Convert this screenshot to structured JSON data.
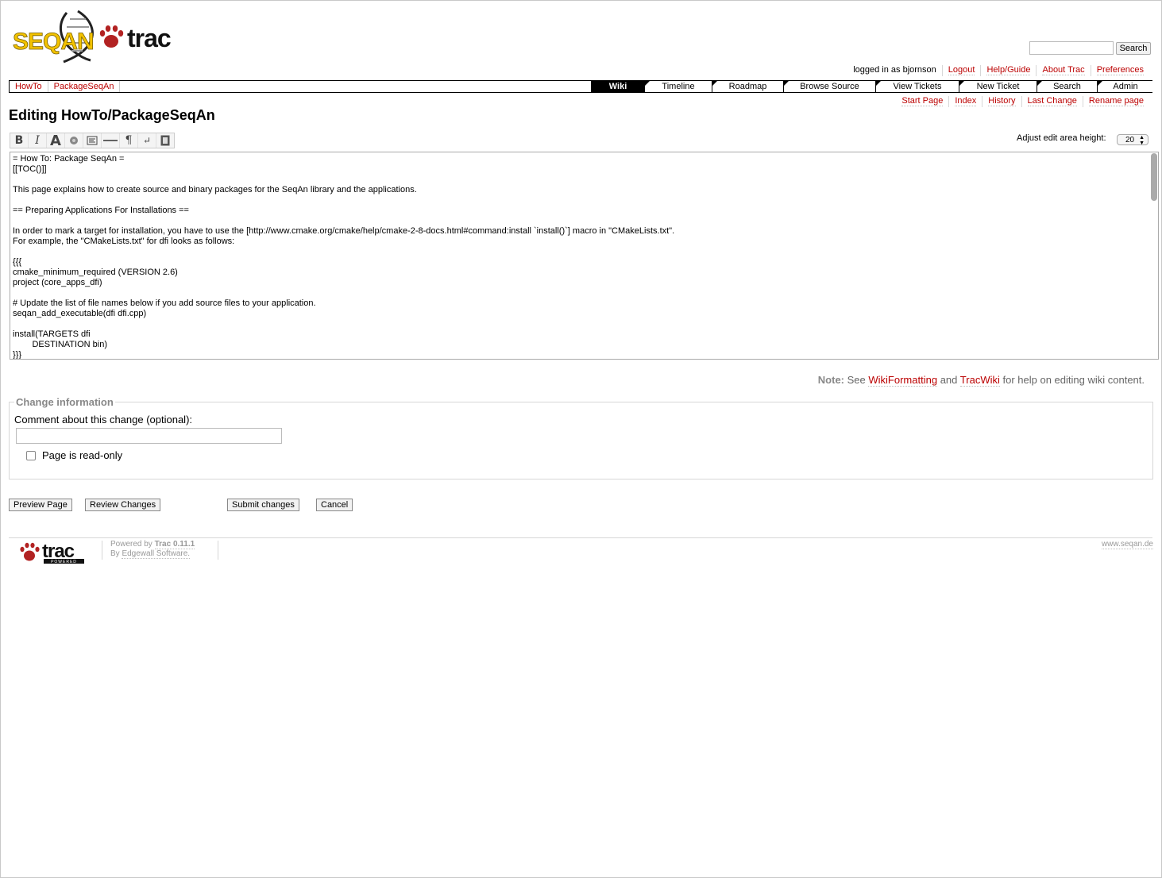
{
  "header": {
    "search_button": "Search",
    "search_value": ""
  },
  "metanav": {
    "logged_in": "logged in as bjornson",
    "logout": "Logout",
    "help": "Help/Guide",
    "about": "About Trac",
    "preferences": "Preferences"
  },
  "context_path": [
    "HowTo",
    "PackageSeqAn"
  ],
  "mainnav": [
    "Wiki",
    "Timeline",
    "Roadmap",
    "Browse Source",
    "View Tickets",
    "New Ticket",
    "Search",
    "Admin"
  ],
  "ctxtnav": [
    "Start Page",
    "Index",
    "History",
    "Last Change",
    "Rename page"
  ],
  "page_title": "Editing HowTo/PackageSeqAn",
  "toolbar_icons": [
    "bold-icon",
    "italic-icon",
    "heading-icon",
    "link-icon",
    "code-block-icon",
    "horizontal-rule-icon",
    "paragraph-icon",
    "line-break-icon",
    "image-icon"
  ],
  "adjust": {
    "label": "Adjust edit area height:",
    "value": "20"
  },
  "editor_text": "= How To: Package SeqAn =\n[[TOC()]]\n\nThis page explains how to create source and binary packages for the SeqAn library and the applications.\n\n== Preparing Applications For Installations ==\n\nIn order to mark a target for installation, you have to use the [http://www.cmake.org/cmake/help/cmake-2-8-docs.html#command:install `install()`] macro in \"CMakeLists.txt\".\nFor example, the \"CMakeLists.txt\" for dfi looks as follows:\n\n{{{\ncmake_minimum_required (VERSION 2.6)\nproject (core_apps_dfi)\n\n# Update the list of file names below if you add source files to your application.\nseqan_add_executable(dfi dfi.cpp)\n\ninstall(TARGETS dfi\n\tDESTINATION bin)\n}}}",
  "note": {
    "label": "Note:",
    "see": "See",
    "link1": "WikiFormatting",
    "and": "and",
    "link2": "TracWiki",
    "rest": "for help on editing wiki content."
  },
  "change_info": {
    "legend": "Change information",
    "comment_label": "Comment about this change (optional):",
    "comment_value": "",
    "readonly_label": "Page is read-only",
    "readonly_checked": false
  },
  "buttons": {
    "preview": "Preview Page",
    "review": "Review Changes",
    "submit": "Submit changes",
    "cancel": "Cancel"
  },
  "footer": {
    "powered_by": "Powered by",
    "trac_version": "Trac 0.11.1",
    "by": "By",
    "edgewall": "Edgewall Software.",
    "site": "www.seqan.de"
  },
  "colors": {
    "link": "#bb0000",
    "logo_yellow": "#f2c200",
    "paw_red": "#b22222"
  }
}
